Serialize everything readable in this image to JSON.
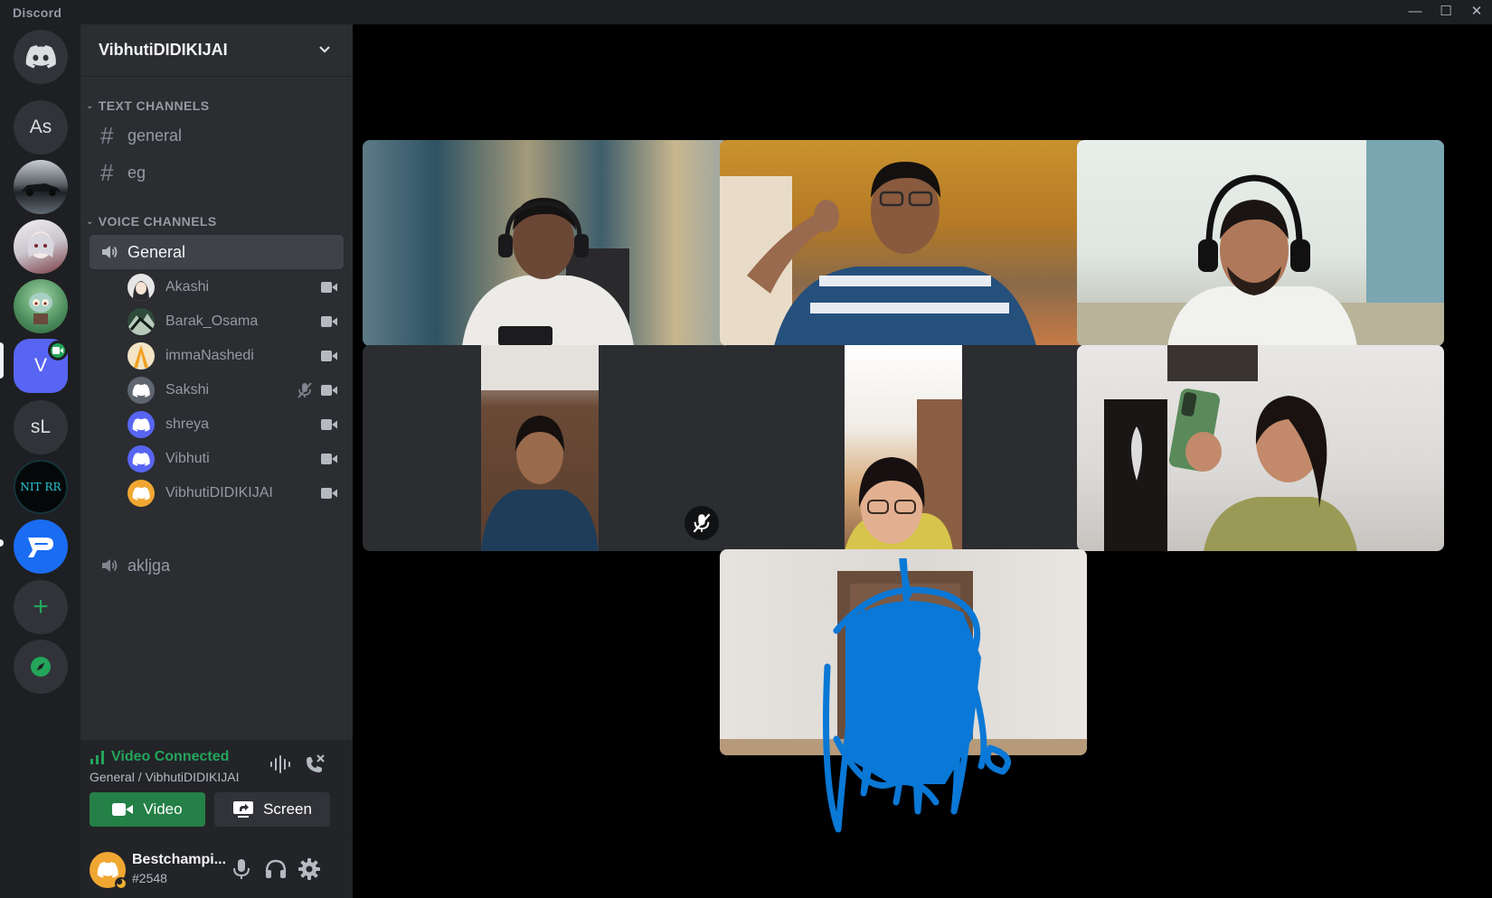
{
  "window": {
    "title": "Discord",
    "minimize": "—",
    "maximize": "☐",
    "close": "✕"
  },
  "servers": [
    {
      "name": "home",
      "label": ""
    },
    {
      "name": "as",
      "label": "As"
    },
    {
      "name": "car",
      "label": ""
    },
    {
      "name": "anime",
      "label": ""
    },
    {
      "name": "squid",
      "label": ""
    },
    {
      "name": "v",
      "label": "V"
    },
    {
      "name": "sl",
      "label": "sL"
    },
    {
      "name": "nitrr",
      "label": "NIT RR"
    },
    {
      "name": "p",
      "label": ""
    },
    {
      "name": "add",
      "label": "+"
    },
    {
      "name": "explore",
      "label": ""
    }
  ],
  "guild": {
    "name": "VibhutiDIDIKIJAI"
  },
  "categories": {
    "text": "TEXT CHANNELS",
    "voice": "VOICE CHANNELS"
  },
  "text_channels": [
    "general",
    "eg"
  ],
  "voice_channels": [
    {
      "name": "General",
      "active": true
    },
    {
      "name": "akljga",
      "active": false
    }
  ],
  "voice_users": [
    {
      "name": "Akashi",
      "avatar_color": "#e6e6e6",
      "muted": false
    },
    {
      "name": "Barak_Osama",
      "avatar_color": "#2f4a3a",
      "muted": false
    },
    {
      "name": "immaNashedi",
      "avatar_color": "#f3e4c5",
      "muted": false
    },
    {
      "name": "Sakshi",
      "avatar_color": "#5f6670",
      "muted": true
    },
    {
      "name": "shreya",
      "avatar_color": "#5865f2",
      "muted": false
    },
    {
      "name": "Vibhuti",
      "avatar_color": "#5865f2",
      "muted": false
    },
    {
      "name": "VibhutiDIDIKIJAI",
      "avatar_color": "#f0a732",
      "muted": false
    }
  ],
  "voice_status": {
    "title": "Video Connected",
    "subtitle": "General / VibhutiDIDIKIJAI",
    "video_label": "Video",
    "screen_label": "Screen",
    "status_color": "#23a55a"
  },
  "user": {
    "name": "Bestchampi...",
    "tag": "#2548"
  },
  "video_tiles": [
    {
      "name": "tile-1",
      "muted": false
    },
    {
      "name": "tile-2",
      "muted": false
    },
    {
      "name": "tile-3",
      "muted": false
    },
    {
      "name": "tile-4",
      "muted": true
    },
    {
      "name": "tile-5",
      "muted": false
    },
    {
      "name": "tile-6",
      "muted": false
    },
    {
      "name": "tile-7",
      "muted": false
    }
  ]
}
